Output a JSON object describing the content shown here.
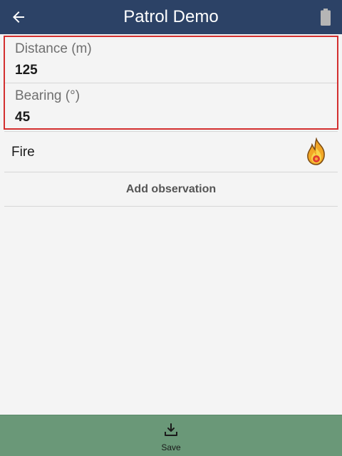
{
  "header": {
    "title": "Patrol Demo",
    "back_icon": "arrow-left-icon",
    "battery_icon": "battery-icon",
    "color": "#2c4266"
  },
  "fields": [
    {
      "label": "Distance (m)",
      "value": "125"
    },
    {
      "label": "Bearing (°)",
      "value": "45"
    }
  ],
  "highlight_color": "#d32f2f",
  "observations": [
    {
      "label": "Fire",
      "icon": "fire-icon"
    }
  ],
  "add_observation_label": "Add observation",
  "footer": {
    "save_label": "Save",
    "save_icon": "download-tray-icon",
    "color": "#6a9878"
  }
}
